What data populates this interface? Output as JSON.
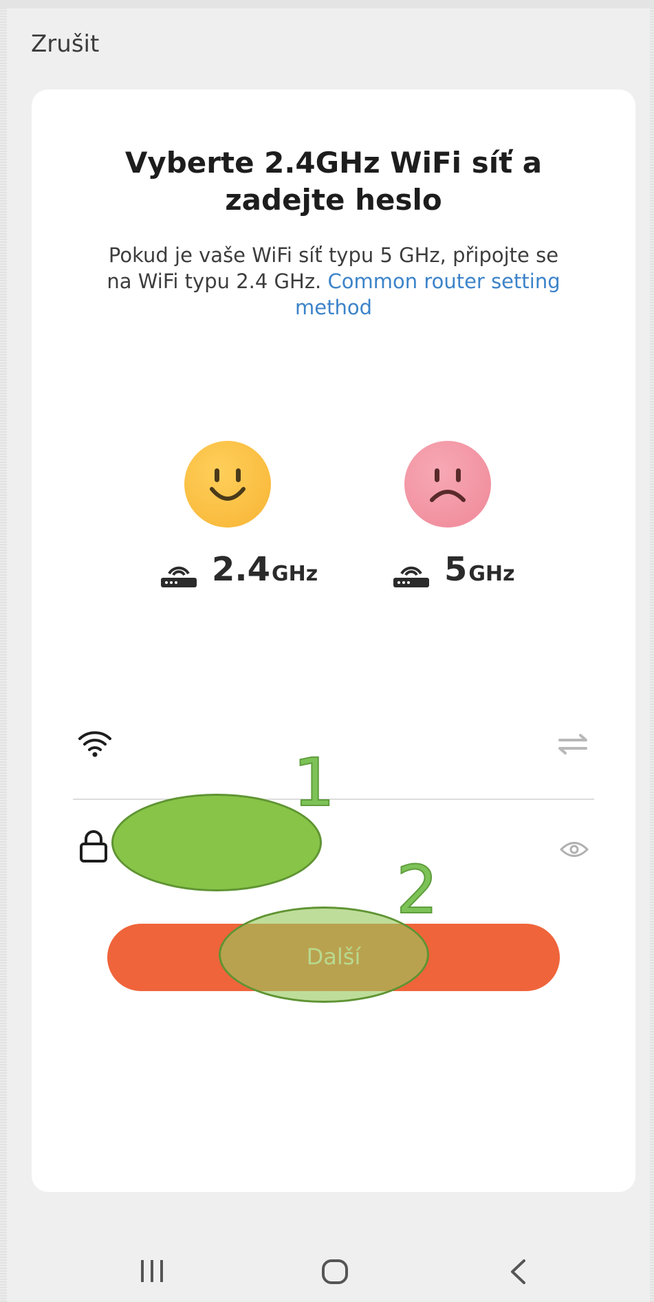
{
  "header": {
    "cancel_label": "Zrušit"
  },
  "card": {
    "title": "Vyberte 2.4GHz WiFi síť a zadejte heslo",
    "subtitle_text": "Pokud je vaše WiFi síť typu 5 GHz, připojte se na WiFi typu 2.4 GHz. ",
    "subtitle_link": "Common router setting method"
  },
  "bands": [
    {
      "number": "2.4",
      "unit": "GHz",
      "face": "happy-face-icon",
      "color": "#f7b434"
    },
    {
      "number": "5",
      "unit": "GHz",
      "face": "sad-face-icon",
      "color": "#ef8798"
    }
  ],
  "form": {
    "wifi_name_value": "",
    "password_value": ""
  },
  "next_button": {
    "label": "Další",
    "color": "#ef643a"
  },
  "annotations": {
    "marker_1": "1",
    "marker_2": "2"
  },
  "icons": [
    "wifi-icon",
    "switch-network-icon",
    "lock-icon",
    "eye-icon",
    "router-icon",
    "nav-recent-icon",
    "nav-home-icon",
    "nav-back-icon"
  ]
}
